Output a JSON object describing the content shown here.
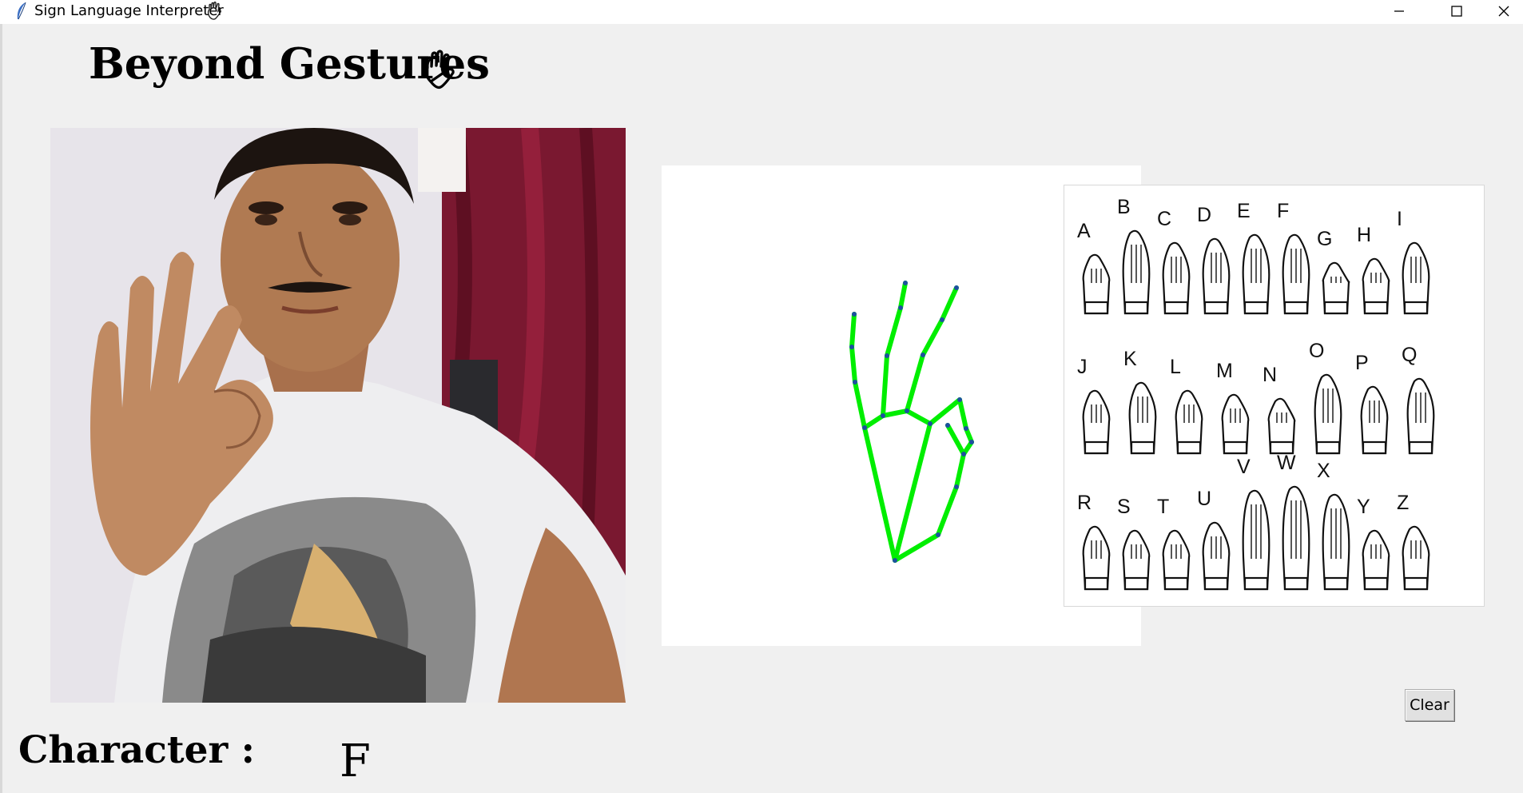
{
  "window": {
    "title": "Sign Language Interpreter",
    "icons": {
      "app": "feather-icon",
      "title_suffix": "hand-icon"
    },
    "controls": [
      "minimize-icon",
      "maximize-icon",
      "close-icon"
    ]
  },
  "header": {
    "title": "Beyond Gestures",
    "icon": "raised-hand-icon"
  },
  "panels": {
    "webcam": "webcam-feed-image",
    "skeleton": {
      "icon": "hand-landmark-skeleton",
      "line_color": "#00ee00",
      "point_color": "#1e4fa0"
    },
    "reference": {
      "icon": "asl-alphabet-chart",
      "letters": [
        "A",
        "B",
        "C",
        "D",
        "E",
        "F",
        "G",
        "H",
        "I",
        "J",
        "K",
        "L",
        "M",
        "N",
        "O",
        "P",
        "Q",
        "R",
        "S",
        "T",
        "U",
        "V",
        "W",
        "X",
        "Y",
        "Z"
      ]
    }
  },
  "result": {
    "label": "Character :",
    "value": "F"
  },
  "actions": {
    "clear_label": "Clear"
  }
}
